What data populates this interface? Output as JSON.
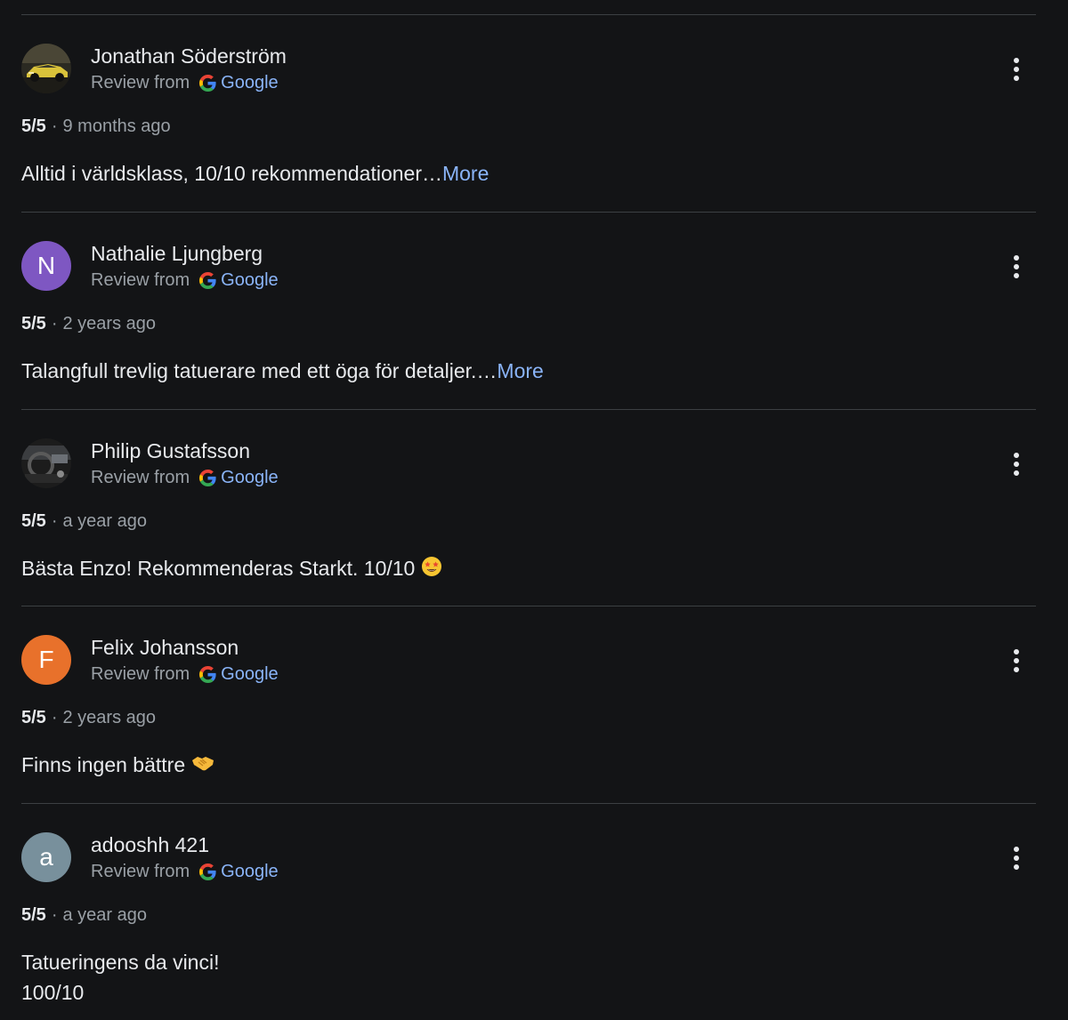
{
  "source_label": "Review from",
  "source_name": "Google",
  "more_label": "More",
  "colors": {
    "background": "#131416",
    "link": "#8ab4f8",
    "secondary_text": "#9aa0a6",
    "primary_text": "#e8eaed",
    "divider": "#3c4043"
  },
  "reviews": [
    {
      "name": "Jonathan Söderström",
      "avatar": "car-photo",
      "rating": "5/5",
      "time": "9 months ago",
      "text": "Alltid i världsklass, 10/10 rekommendationer…"
    },
    {
      "name": "Nathalie Ljungberg",
      "avatar_letter": "N",
      "avatar_color": "#7e57c2",
      "rating": "5/5",
      "time": "2 years ago",
      "text": "Talangfull trevlig tatuerare med ett öga för detaljer.…"
    },
    {
      "name": "Philip Gustafsson",
      "avatar": "car-interior-photo",
      "rating": "5/5",
      "time": "a year ago",
      "text": "Bästa Enzo! Rekommenderas Starkt. 10/10",
      "emoji": "star-struck-emoji"
    },
    {
      "name": "Felix Johansson",
      "avatar_letter": "F",
      "avatar_color": "#e8712b",
      "rating": "5/5",
      "time": "2 years ago",
      "text": "Finns ingen bättre",
      "emoji": "handshake-emoji"
    },
    {
      "name": "adooshh 421",
      "avatar_letter": "a",
      "avatar_color": "#78909c",
      "rating": "5/5",
      "time": "a year ago",
      "text_line1": "Tatueringens da vinci!",
      "text_line2": "100/10"
    }
  ]
}
